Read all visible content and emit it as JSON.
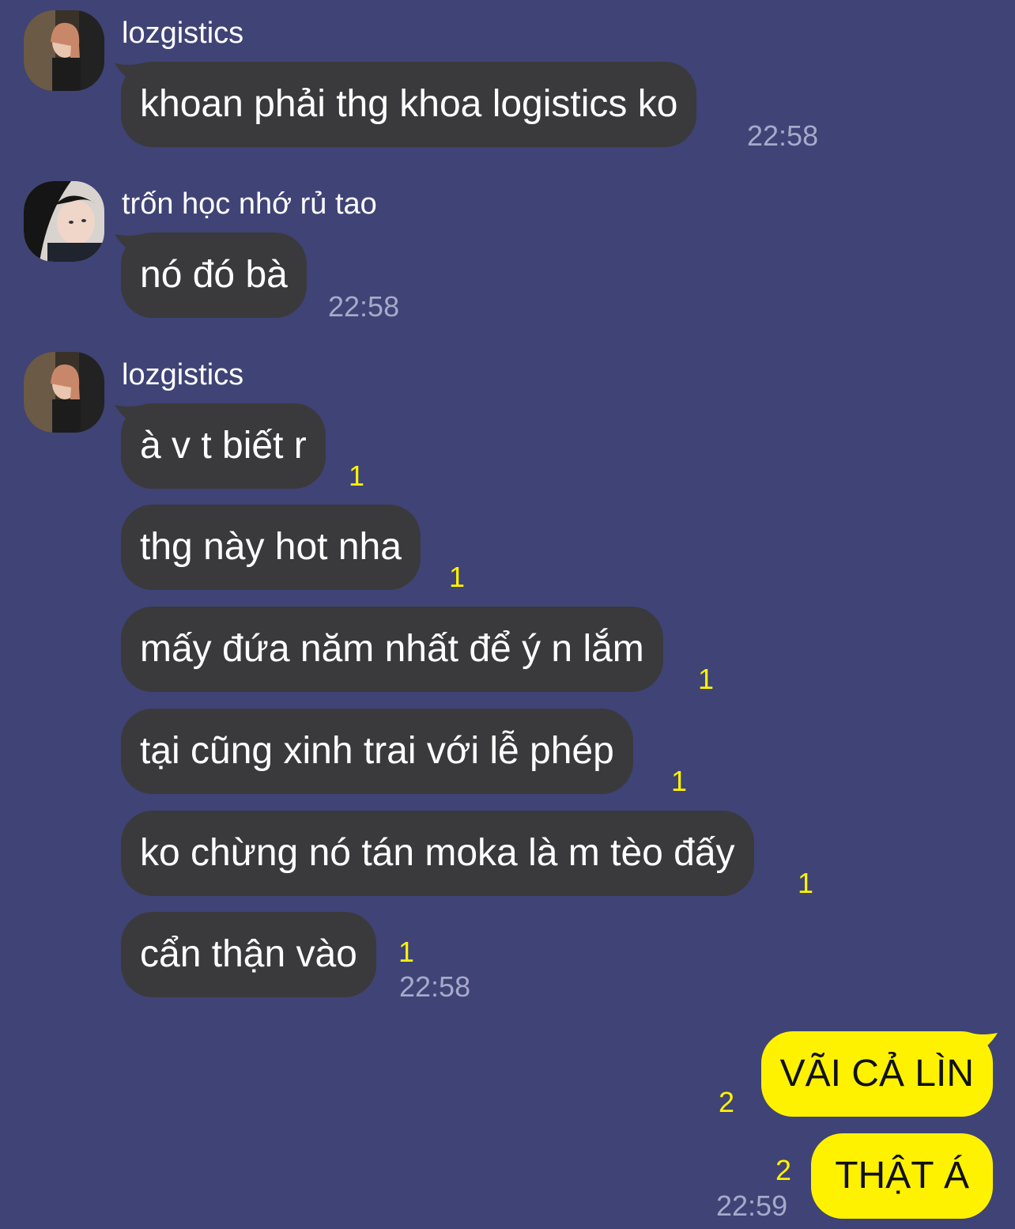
{
  "chat": {
    "groups": [
      {
        "sender": "lozgistics",
        "avatar_icon": "profile-photo-1",
        "messages": [
          {
            "text": "khoan phải thg khoa logistics ko",
            "time": "22:58"
          }
        ]
      },
      {
        "sender": "trốn học nhớ rủ tao",
        "avatar_icon": "profile-photo-2",
        "messages": [
          {
            "text": "nó đó bà",
            "time": "22:58"
          }
        ]
      },
      {
        "sender": "lozgistics",
        "avatar_icon": "profile-photo-1",
        "messages": [
          {
            "text": "à v t biết r",
            "unread": "1"
          },
          {
            "text": "thg này hot nha",
            "unread": "1"
          },
          {
            "text": "mấy đứa năm nhất để ý n lắm",
            "unread": "1"
          },
          {
            "text": "tại cũng xinh trai với lễ phép",
            "unread": "1"
          },
          {
            "text": "ko chừng nó tán moka là m tèo đấy",
            "unread": "1"
          },
          {
            "text": "cẩn thận vào",
            "unread": "1",
            "time": "22:58"
          }
        ]
      }
    ],
    "outgoing": [
      {
        "text": "VÃI CẢ LÌN",
        "unread": "2"
      },
      {
        "text": "THẬT Á",
        "unread": "2",
        "time": "22:59"
      }
    ]
  },
  "colors": {
    "background": "#3f4376",
    "incoming_bubble": "#3a3a3c",
    "outgoing_bubble": "#fff200",
    "unread_count": "#fff200",
    "timestamp": "#a7a9c9"
  }
}
